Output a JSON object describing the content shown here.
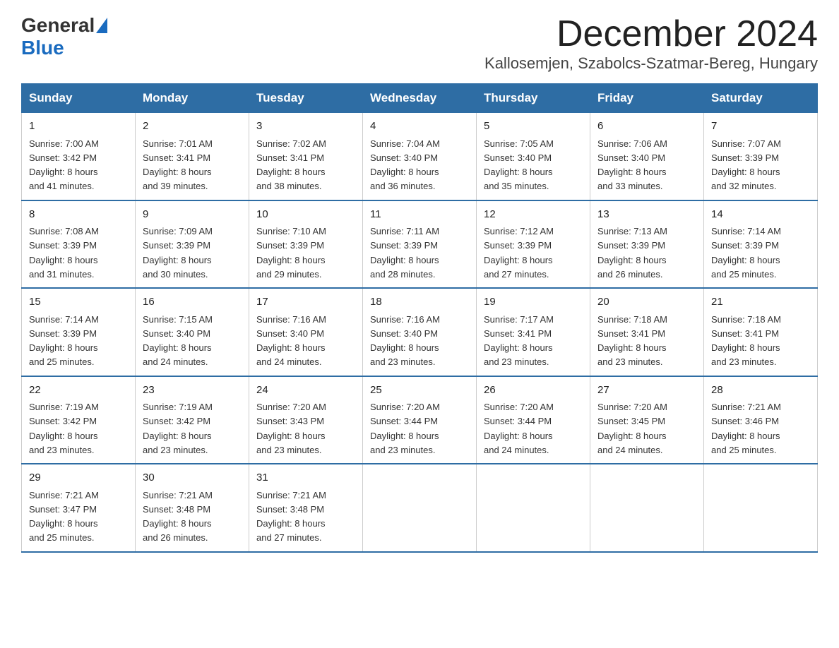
{
  "logo": {
    "general": "General",
    "blue": "Blue"
  },
  "header": {
    "month": "December 2024",
    "location": "Kallosemjen, Szabolcs-Szatmar-Bereg, Hungary"
  },
  "days_of_week": [
    "Sunday",
    "Monday",
    "Tuesday",
    "Wednesday",
    "Thursday",
    "Friday",
    "Saturday"
  ],
  "weeks": [
    [
      {
        "day": "1",
        "sunrise": "7:00 AM",
        "sunset": "3:42 PM",
        "daylight": "8 hours and 41 minutes."
      },
      {
        "day": "2",
        "sunrise": "7:01 AM",
        "sunset": "3:41 PM",
        "daylight": "8 hours and 39 minutes."
      },
      {
        "day": "3",
        "sunrise": "7:02 AM",
        "sunset": "3:41 PM",
        "daylight": "8 hours and 38 minutes."
      },
      {
        "day": "4",
        "sunrise": "7:04 AM",
        "sunset": "3:40 PM",
        "daylight": "8 hours and 36 minutes."
      },
      {
        "day": "5",
        "sunrise": "7:05 AM",
        "sunset": "3:40 PM",
        "daylight": "8 hours and 35 minutes."
      },
      {
        "day": "6",
        "sunrise": "7:06 AM",
        "sunset": "3:40 PM",
        "daylight": "8 hours and 33 minutes."
      },
      {
        "day": "7",
        "sunrise": "7:07 AM",
        "sunset": "3:39 PM",
        "daylight": "8 hours and 32 minutes."
      }
    ],
    [
      {
        "day": "8",
        "sunrise": "7:08 AM",
        "sunset": "3:39 PM",
        "daylight": "8 hours and 31 minutes."
      },
      {
        "day": "9",
        "sunrise": "7:09 AM",
        "sunset": "3:39 PM",
        "daylight": "8 hours and 30 minutes."
      },
      {
        "day": "10",
        "sunrise": "7:10 AM",
        "sunset": "3:39 PM",
        "daylight": "8 hours and 29 minutes."
      },
      {
        "day": "11",
        "sunrise": "7:11 AM",
        "sunset": "3:39 PM",
        "daylight": "8 hours and 28 minutes."
      },
      {
        "day": "12",
        "sunrise": "7:12 AM",
        "sunset": "3:39 PM",
        "daylight": "8 hours and 27 minutes."
      },
      {
        "day": "13",
        "sunrise": "7:13 AM",
        "sunset": "3:39 PM",
        "daylight": "8 hours and 26 minutes."
      },
      {
        "day": "14",
        "sunrise": "7:14 AM",
        "sunset": "3:39 PM",
        "daylight": "8 hours and 25 minutes."
      }
    ],
    [
      {
        "day": "15",
        "sunrise": "7:14 AM",
        "sunset": "3:39 PM",
        "daylight": "8 hours and 25 minutes."
      },
      {
        "day": "16",
        "sunrise": "7:15 AM",
        "sunset": "3:40 PM",
        "daylight": "8 hours and 24 minutes."
      },
      {
        "day": "17",
        "sunrise": "7:16 AM",
        "sunset": "3:40 PM",
        "daylight": "8 hours and 24 minutes."
      },
      {
        "day": "18",
        "sunrise": "7:16 AM",
        "sunset": "3:40 PM",
        "daylight": "8 hours and 23 minutes."
      },
      {
        "day": "19",
        "sunrise": "7:17 AM",
        "sunset": "3:41 PM",
        "daylight": "8 hours and 23 minutes."
      },
      {
        "day": "20",
        "sunrise": "7:18 AM",
        "sunset": "3:41 PM",
        "daylight": "8 hours and 23 minutes."
      },
      {
        "day": "21",
        "sunrise": "7:18 AM",
        "sunset": "3:41 PM",
        "daylight": "8 hours and 23 minutes."
      }
    ],
    [
      {
        "day": "22",
        "sunrise": "7:19 AM",
        "sunset": "3:42 PM",
        "daylight": "8 hours and 23 minutes."
      },
      {
        "day": "23",
        "sunrise": "7:19 AM",
        "sunset": "3:42 PM",
        "daylight": "8 hours and 23 minutes."
      },
      {
        "day": "24",
        "sunrise": "7:20 AM",
        "sunset": "3:43 PM",
        "daylight": "8 hours and 23 minutes."
      },
      {
        "day": "25",
        "sunrise": "7:20 AM",
        "sunset": "3:44 PM",
        "daylight": "8 hours and 23 minutes."
      },
      {
        "day": "26",
        "sunrise": "7:20 AM",
        "sunset": "3:44 PM",
        "daylight": "8 hours and 24 minutes."
      },
      {
        "day": "27",
        "sunrise": "7:20 AM",
        "sunset": "3:45 PM",
        "daylight": "8 hours and 24 minutes."
      },
      {
        "day": "28",
        "sunrise": "7:21 AM",
        "sunset": "3:46 PM",
        "daylight": "8 hours and 25 minutes."
      }
    ],
    [
      {
        "day": "29",
        "sunrise": "7:21 AM",
        "sunset": "3:47 PM",
        "daylight": "8 hours and 25 minutes."
      },
      {
        "day": "30",
        "sunrise": "7:21 AM",
        "sunset": "3:48 PM",
        "daylight": "8 hours and 26 minutes."
      },
      {
        "day": "31",
        "sunrise": "7:21 AM",
        "sunset": "3:48 PM",
        "daylight": "8 hours and 27 minutes."
      },
      null,
      null,
      null,
      null
    ]
  ],
  "labels": {
    "sunrise": "Sunrise:",
    "sunset": "Sunset:",
    "daylight": "Daylight:"
  }
}
